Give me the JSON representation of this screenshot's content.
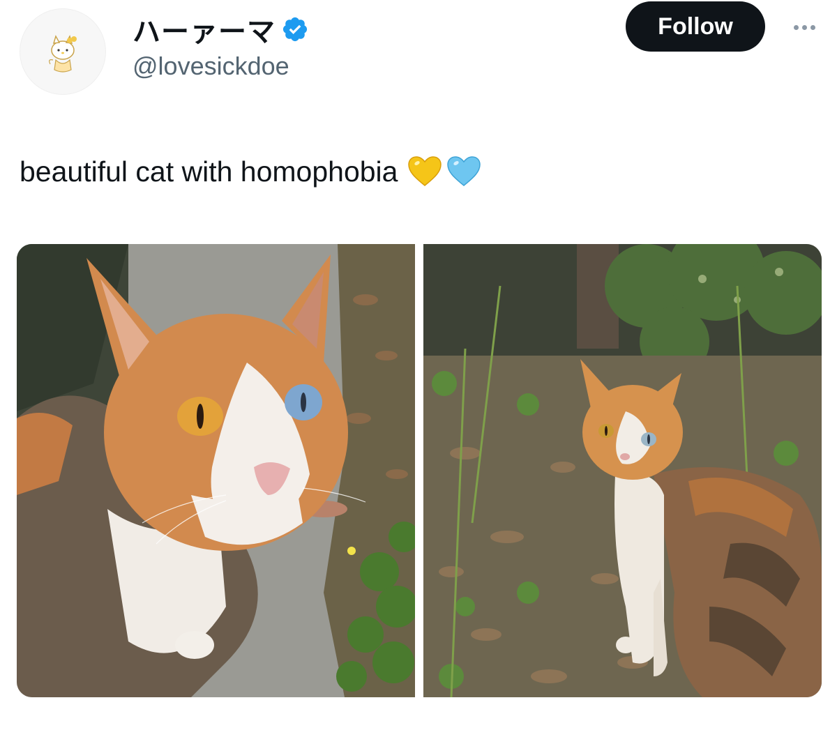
{
  "user": {
    "display_name": "ハーァーマ",
    "handle": "@lovesickdoe",
    "verified": true,
    "avatar_icon": "hello-kitty-avatar-icon"
  },
  "actions": {
    "follow_label": "Follow",
    "more_icon": "more-dots-icon"
  },
  "tweet": {
    "text": "beautiful cat with homophobia",
    "emojis": [
      "yellow-heart-icon",
      "blue-heart-icon"
    ]
  },
  "media": {
    "count": 2,
    "photos": [
      "cat-closeup-photo",
      "cat-in-garden-photo"
    ]
  },
  "colors": {
    "follow_bg": "#0f1419",
    "verified": "#1d9bf0",
    "handle": "#536471",
    "yellow_heart": "#f5c518",
    "blue_heart": "#6ec6f0"
  }
}
